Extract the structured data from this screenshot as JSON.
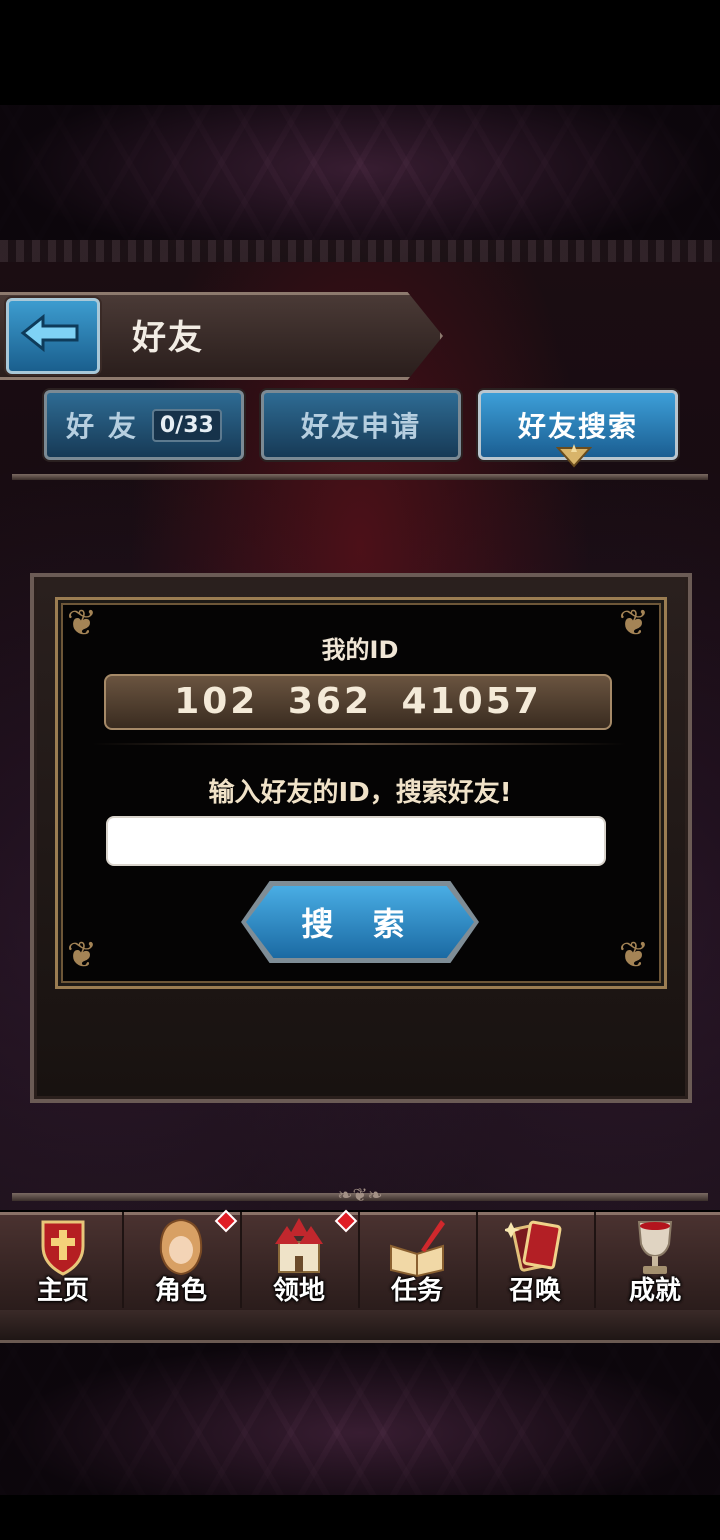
{
  "header": {
    "title": "好友"
  },
  "tabs": [
    {
      "label": "好 友",
      "count": "0/33",
      "active": false
    },
    {
      "label": "好友申请",
      "active": false
    },
    {
      "label": "好友搜索",
      "active": true
    }
  ],
  "panel": {
    "my_id_label": "我的ID",
    "my_id_value": "102 362 41057",
    "prompt": "输入好友的ID，搜索好友!",
    "search_placeholder": "",
    "search_button": "搜 索"
  },
  "nav": [
    {
      "label": "主页",
      "icon": "shield-icon",
      "badge": false
    },
    {
      "label": "角色",
      "icon": "character-icon",
      "badge": true
    },
    {
      "label": "领地",
      "icon": "castle-icon",
      "badge": true
    },
    {
      "label": "任务",
      "icon": "quest-book-icon",
      "badge": false
    },
    {
      "label": "召唤",
      "icon": "summon-cards-icon",
      "badge": false
    },
    {
      "label": "成就",
      "icon": "trophy-icon",
      "badge": false
    }
  ],
  "colors": {
    "accent_blue": "#3d9fd8",
    "badge_red": "#e01d25",
    "gold_frame": "#9b7d52"
  }
}
